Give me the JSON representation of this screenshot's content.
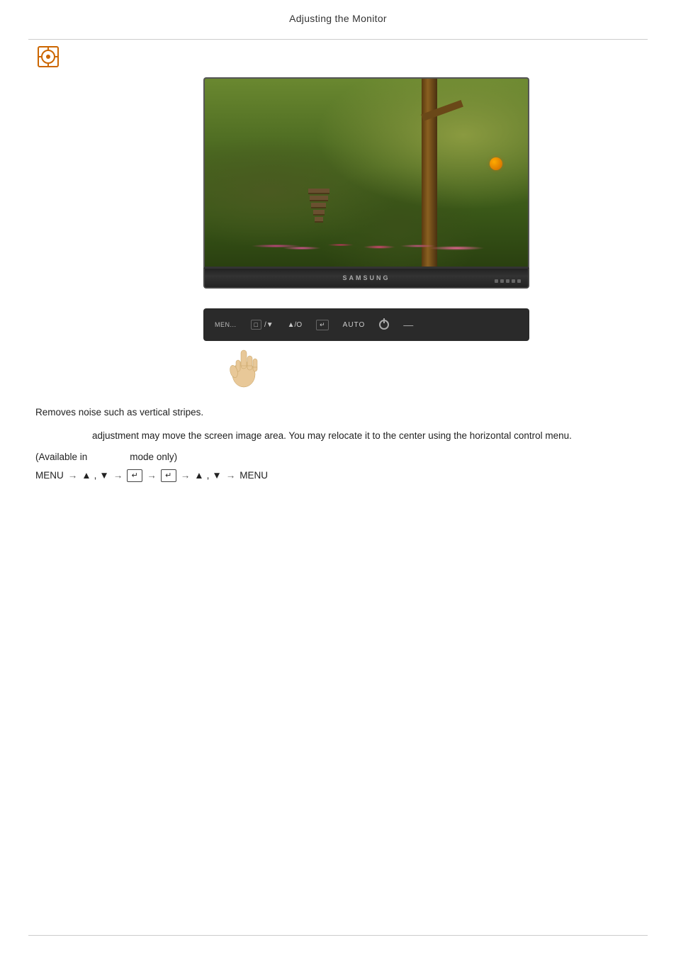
{
  "header": {
    "title": "Adjusting the Monitor"
  },
  "icon": {
    "name": "coarse-adjust-icon",
    "symbol": "⊕"
  },
  "monitor": {
    "brand": "SAMSUNG"
  },
  "content": {
    "description": "Removes noise such as vertical stripes.",
    "indent_note": "adjustment may move the screen image area. You may relocate it to the center using the horizontal control menu.",
    "available_prefix": "(Available in",
    "available_mode": "",
    "available_suffix": "mode only)",
    "menu_nav_text": "MENU → ▲ , ▼ → ↵ → ↵ → ▲ , ▼ → MENU"
  },
  "controls": {
    "menu_label": "MEN...",
    "btn1": "□/▼",
    "btn2": "▲/O",
    "btn3": "⊡",
    "btn4": "AUTO",
    "btn5": "⏻",
    "btn6": "—"
  }
}
